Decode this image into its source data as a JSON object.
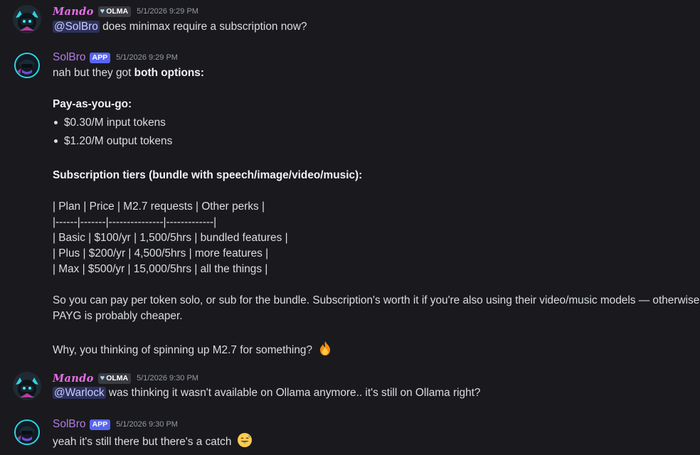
{
  "colors": {
    "background": "#1a1a1e",
    "mando_name": "#e36ee5",
    "solbro_name": "#b37be3",
    "app_badge": "#5865f2",
    "mention_bg": "#3c4270",
    "timestamp": "#949ba4"
  },
  "messages": [
    {
      "author": "Mando",
      "tag": "OLMA",
      "timestamp": "5/1/2026 9:29 PM",
      "mention": "@SolBro",
      "text": " does minimax require a subscription now?"
    },
    {
      "author": "SolBro",
      "badge": "APP",
      "timestamp": "5/1/2026 9:29 PM",
      "intro": "nah but they got ",
      "intro_bold": "both options:",
      "payg_heading": "Pay-as-you-go:",
      "payg_items": [
        "$0.30/M input tokens",
        "$1.20/M output tokens"
      ],
      "sub_heading": "Subscription tiers (bundle with speech/image/video/music):",
      "table_lines": [
        "| Plan | Price | M2.7 requests | Other perks |",
        "|------|-------|---------------|-------------|",
        "| Basic | $100/yr | 1,500/5hrs | bundled features |",
        "| Plus | $200/yr | 4,500/5hrs | more features |",
        "| Max | $500/yr | 15,000/5hrs | all the things |"
      ],
      "summary_line1": "So you can pay per token solo, or sub for the bundle. Subscription's worth it if you're also using their video/music models — otherwise",
      "summary_line2": "PAYG is probably cheaper.",
      "question": "Why, you thinking of spinning up M2.7 for something?",
      "question_emoji": "fire-emoji"
    },
    {
      "author": "Mando",
      "tag": "OLMA",
      "timestamp": "5/1/2026 9:30 PM",
      "mention": "@Warlock",
      "text": " was thinking it wasn't available on Ollama anymore.. it's still on Ollama right?"
    },
    {
      "author": "SolBro",
      "badge": "APP",
      "timestamp": "5/1/2026 9:30 PM",
      "text": "yeah it's still there but there's a catch",
      "emoji": "sweat-smile-emoji"
    }
  ]
}
